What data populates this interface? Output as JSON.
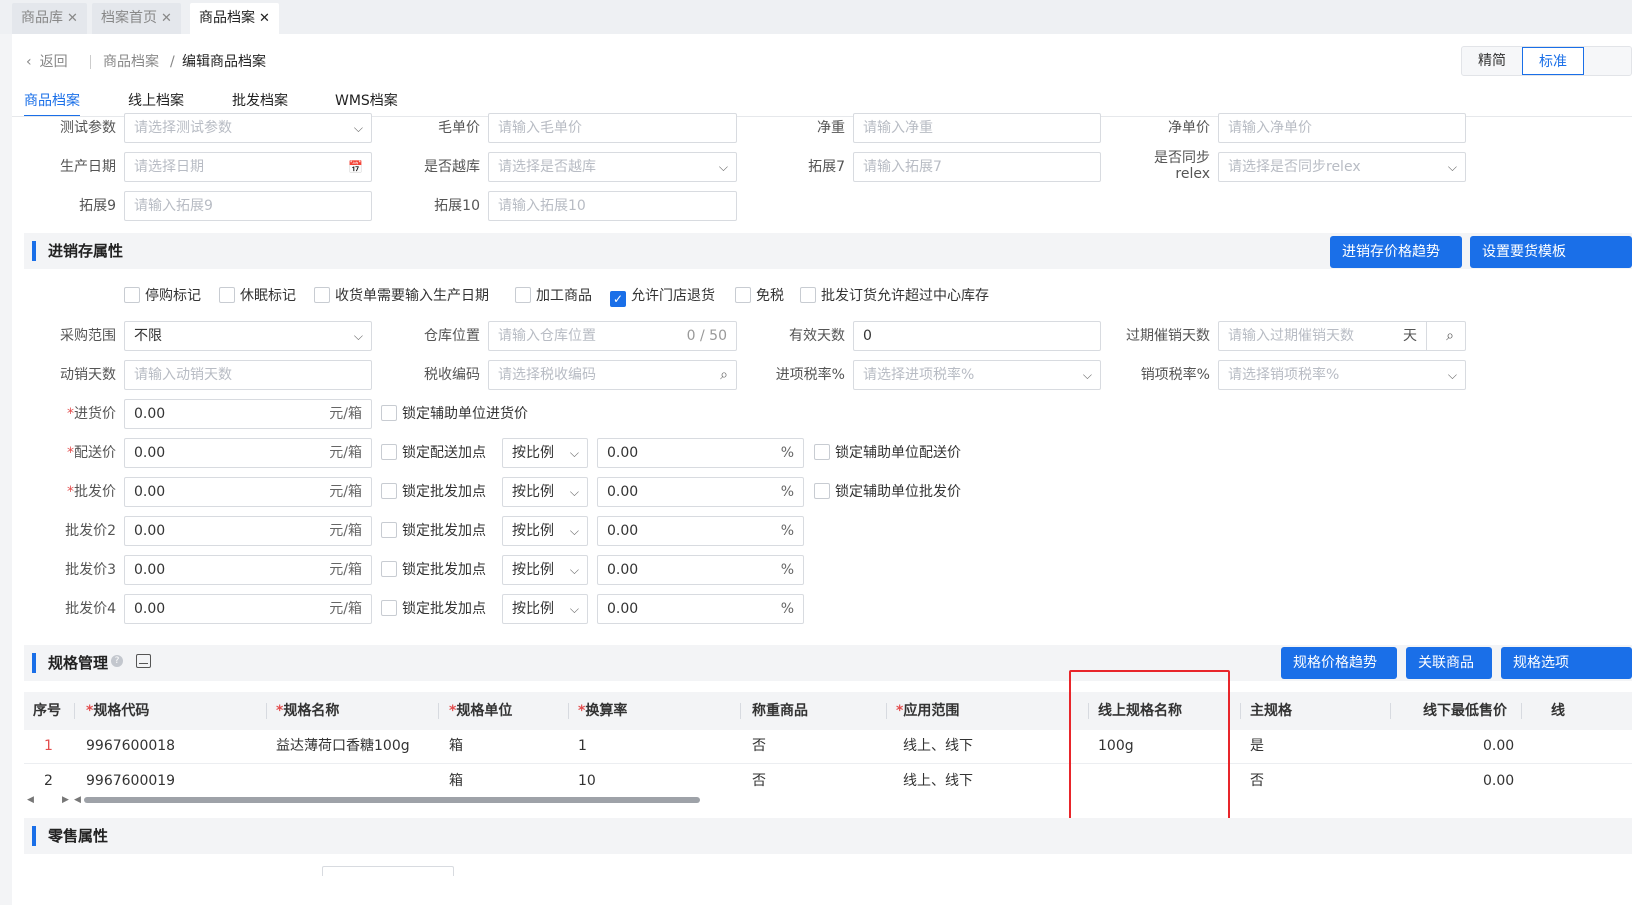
{
  "page_tabs": [
    {
      "label": "商品库"
    },
    {
      "label": "档案首页"
    },
    {
      "label": "商品档案"
    }
  ],
  "breadcrumb": {
    "back": "返回",
    "parent": "商品档案",
    "sep": "/",
    "current": "编辑商品档案"
  },
  "view_mode": {
    "simple": "精简",
    "standard": "标准"
  },
  "subtabs": [
    "商品档案",
    "线上档案",
    "批发档案",
    "WMS档案"
  ],
  "top_fields": {
    "r1": [
      {
        "label": "测试参数",
        "ph": "请选择测试参数"
      },
      {
        "label": "毛单价",
        "ph": "请输入毛单价"
      },
      {
        "label": "净重",
        "ph": "请输入净重"
      },
      {
        "label": "净单价",
        "ph": "请输入净单价"
      }
    ],
    "r2": [
      {
        "label": "生产日期",
        "ph": "请选择日期"
      },
      {
        "label": "是否越库",
        "ph": "请选择是否越库"
      },
      {
        "label": "拓展7",
        "ph": "请输入拓展7"
      },
      {
        "label1": "是否同步",
        "label2": "relex",
        "ph": "请选择是否同步relex"
      }
    ],
    "r3": [
      {
        "label": "拓展9",
        "ph": "请输入拓展9"
      },
      {
        "label": "拓展10",
        "ph": "请输入拓展10"
      }
    ]
  },
  "inventory": {
    "title": "进销存属性",
    "btn_trend": "进销存价格趋势",
    "btn_template": "设置要货模板",
    "checkboxes": [
      {
        "label": "停购标记",
        "checked": false
      },
      {
        "label": "休眠标记",
        "checked": false
      },
      {
        "label": "收货单需要输入生产日期",
        "checked": false
      },
      {
        "label": "加工商品",
        "checked": false
      },
      {
        "label": "允许门店退货",
        "checked": true
      },
      {
        "label": "免税",
        "checked": false
      },
      {
        "label": "批发订货允许超过中心库存",
        "checked": false
      }
    ],
    "purchase_scope": {
      "label": "采购范围",
      "value": "不限"
    },
    "location": {
      "label": "仓库位置",
      "ph": "请输入仓库位置",
      "count": "0 / 50"
    },
    "valid_days": {
      "label": "有效天数",
      "value": "0"
    },
    "expire_days": {
      "label": "过期催销天数",
      "ph": "请输入过期催销天数",
      "unit": "天"
    },
    "move_days": {
      "label": "动销天数",
      "ph": "请输入动销天数"
    },
    "tax_code": {
      "label": "税收编码",
      "ph": "请选择税收编码"
    },
    "in_tax": {
      "label": "进项税率%",
      "ph": "请选择进项税率%"
    },
    "out_tax": {
      "label": "销项税率%",
      "ph": "请选择销项税率%"
    },
    "price_rows": [
      {
        "label": "进货价",
        "req": "*",
        "value": "0.00",
        "unit": "元/箱",
        "lock": "锁定辅助单位进货价"
      },
      {
        "label": "配送价",
        "req": "*",
        "value": "0.00",
        "unit": "元/箱",
        "lock": "锁定配送加点",
        "mode": "按比例",
        "pct": "0.00",
        "pct_unit": "%",
        "lock2": "锁定辅助单位配送价"
      },
      {
        "label": "批发价",
        "req": "*",
        "value": "0.00",
        "unit": "元/箱",
        "lock": "锁定批发加点",
        "mode": "按比例",
        "pct": "0.00",
        "pct_unit": "%",
        "lock2": "锁定辅助单位批发价"
      },
      {
        "label": "批发价2",
        "value": "0.00",
        "unit": "元/箱",
        "lock": "锁定批发加点",
        "mode": "按比例",
        "pct": "0.00",
        "pct_unit": "%"
      },
      {
        "label": "批发价3",
        "value": "0.00",
        "unit": "元/箱",
        "lock": "锁定批发加点",
        "mode": "按比例",
        "pct": "0.00",
        "pct_unit": "%"
      },
      {
        "label": "批发价4",
        "value": "0.00",
        "unit": "元/箱",
        "lock": "锁定批发加点",
        "mode": "按比例",
        "pct": "0.00",
        "pct_unit": "%"
      }
    ]
  },
  "spec": {
    "title": "规格管理",
    "btn_trend": "规格价格趋势",
    "btn_related": "关联商品",
    "btn_options": "规格选项",
    "headers": [
      {
        "req": "",
        "label": "序号"
      },
      {
        "req": "*",
        "label": "规格代码"
      },
      {
        "req": "*",
        "label": "规格名称"
      },
      {
        "req": "*",
        "label": "规格单位"
      },
      {
        "req": "*",
        "label": "换算率"
      },
      {
        "req": "",
        "label": "称重商品"
      },
      {
        "req": "*",
        "label": "应用范围"
      },
      {
        "req": "",
        "label": "线上规格名称"
      },
      {
        "req": "",
        "label": "主规格"
      },
      {
        "req": "",
        "label": "线下最低售价"
      },
      {
        "req": "",
        "label": "线"
      }
    ],
    "rows": [
      {
        "no": "1",
        "code": "9967600018",
        "name": "益达薄荷口香糖100g",
        "unit": "箱",
        "rate": "1",
        "weigh": "否",
        "scope": "线上、线下",
        "online_name": "100g",
        "main": "是",
        "min_price": "0.00"
      },
      {
        "no": "2",
        "code": "9967600019",
        "name": "",
        "unit": "箱",
        "rate": "10",
        "weigh": "否",
        "scope": "线上、线下",
        "online_name": "",
        "main": "否",
        "min_price": "0.00"
      }
    ]
  },
  "retail": {
    "title": "零售属性"
  },
  "colors": {
    "accent": "#1a6fe8",
    "required": "#e34d4d",
    "highlight": "#e8252a"
  }
}
